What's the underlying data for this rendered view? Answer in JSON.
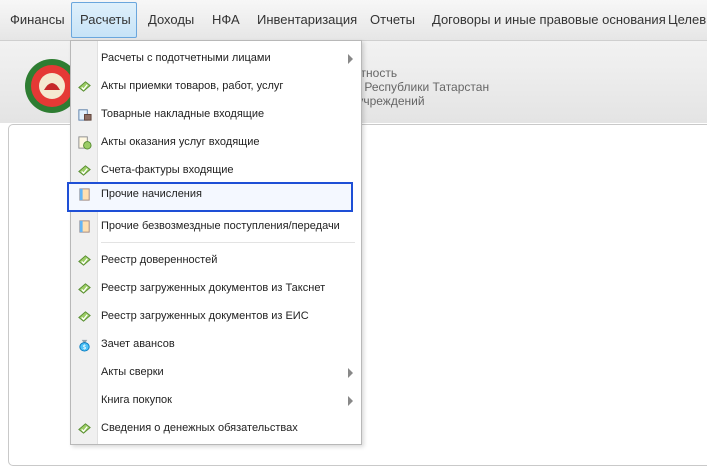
{
  "menubar": {
    "items": [
      {
        "label": "Финансы"
      },
      {
        "label": "Расчеты",
        "active": true
      },
      {
        "label": "Доходы"
      },
      {
        "label": "НФА"
      },
      {
        "label": "Инвентаризация"
      },
      {
        "label": "Отчеты"
      },
      {
        "label": "Договоры и иные правовые основания"
      },
      {
        "label": "Целев"
      }
    ]
  },
  "header": {
    "line1": "четность",
    "line2": "ов Республики Татарстан",
    "line3": "х учреждений"
  },
  "dropdown": {
    "items": [
      {
        "label": "Расчеты с подотчетными лицами",
        "icon": "none",
        "submenu": true
      },
      {
        "label": "Акты приемки товаров, работ, услуг",
        "icon": "approve-document-icon",
        "submenu": false
      },
      {
        "label": "Товарные накладные входящие",
        "icon": "invoice-box-icon",
        "submenu": false
      },
      {
        "label": "Акты оказания услуг входящие",
        "icon": "service-document-icon",
        "submenu": false
      },
      {
        "label": "Счета-фактуры входящие",
        "icon": "approve-document-icon",
        "submenu": false
      },
      {
        "label": "Прочие начисления",
        "icon": "book-icon",
        "submenu": false,
        "highlighted": true
      },
      {
        "label": "Прочие безвозмездные поступления/передачи",
        "icon": "book-icon",
        "submenu": false
      },
      {
        "label": "Реестр доверенностей",
        "icon": "approve-document-icon",
        "submenu": false
      },
      {
        "label": "Реестр загруженных документов из Такснет",
        "icon": "approve-document-icon",
        "submenu": false
      },
      {
        "label": "Реестр загруженных документов из ЕИС",
        "icon": "approve-document-icon",
        "submenu": false
      },
      {
        "label": "Зачет авансов",
        "icon": "money-bag-icon",
        "submenu": false
      },
      {
        "label": "Акты сверки",
        "icon": "none",
        "submenu": true
      },
      {
        "label": "Книга покупок",
        "icon": "none",
        "submenu": true
      },
      {
        "label": "Сведения о денежных обязательствах",
        "icon": "approve-document-icon",
        "submenu": false
      }
    ]
  },
  "colors": {
    "highlight_border": "#1e4fd6",
    "active_menu_bg": "#c7e3f7",
    "icon_green": "#7cb342"
  }
}
